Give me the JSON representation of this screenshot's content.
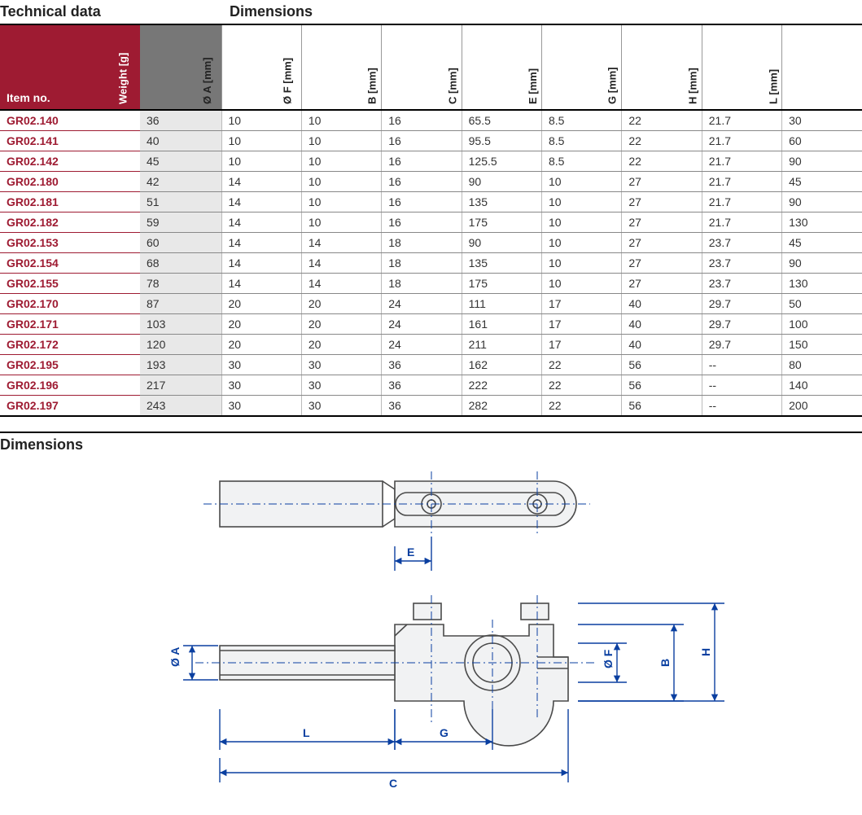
{
  "headings": {
    "technical_data": "Technical data",
    "dimensions": "Dimensions",
    "dimensions_lower": "Dimensions"
  },
  "columns": {
    "item_no": "Item no.",
    "weight": "Weight [g]",
    "a": "Ø A [mm]",
    "f": "Ø F [mm]",
    "b": "B [mm]",
    "c": "C [mm]",
    "e": "E [mm]",
    "g": "G [mm]",
    "h": "H [mm]",
    "l": "L [mm]"
  },
  "rows": [
    {
      "item": "GR02.140",
      "w": "36",
      "a": "10",
      "f": "10",
      "b": "16",
      "c": "65.5",
      "e": "8.5",
      "g": "22",
      "h": "21.7",
      "l": "30"
    },
    {
      "item": "GR02.141",
      "w": "40",
      "a": "10",
      "f": "10",
      "b": "16",
      "c": "95.5",
      "e": "8.5",
      "g": "22",
      "h": "21.7",
      "l": "60"
    },
    {
      "item": "GR02.142",
      "w": "45",
      "a": "10",
      "f": "10",
      "b": "16",
      "c": "125.5",
      "e": "8.5",
      "g": "22",
      "h": "21.7",
      "l": "90"
    },
    {
      "item": "GR02.180",
      "w": "42",
      "a": "14",
      "f": "10",
      "b": "16",
      "c": "90",
      "e": "10",
      "g": "27",
      "h": "21.7",
      "l": "45"
    },
    {
      "item": "GR02.181",
      "w": "51",
      "a": "14",
      "f": "10",
      "b": "16",
      "c": "135",
      "e": "10",
      "g": "27",
      "h": "21.7",
      "l": "90"
    },
    {
      "item": "GR02.182",
      "w": "59",
      "a": "14",
      "f": "10",
      "b": "16",
      "c": "175",
      "e": "10",
      "g": "27",
      "h": "21.7",
      "l": "130"
    },
    {
      "item": "GR02.153",
      "w": "60",
      "a": "14",
      "f": "14",
      "b": "18",
      "c": "90",
      "e": "10",
      "g": "27",
      "h": "23.7",
      "l": "45"
    },
    {
      "item": "GR02.154",
      "w": "68",
      "a": "14",
      "f": "14",
      "b": "18",
      "c": "135",
      "e": "10",
      "g": "27",
      "h": "23.7",
      "l": "90"
    },
    {
      "item": "GR02.155",
      "w": "78",
      "a": "14",
      "f": "14",
      "b": "18",
      "c": "175",
      "e": "10",
      "g": "27",
      "h": "23.7",
      "l": "130"
    },
    {
      "item": "GR02.170",
      "w": "87",
      "a": "20",
      "f": "20",
      "b": "24",
      "c": "111",
      "e": "17",
      "g": "40",
      "h": "29.7",
      "l": "50"
    },
    {
      "item": "GR02.171",
      "w": "103",
      "a": "20",
      "f": "20",
      "b": "24",
      "c": "161",
      "e": "17",
      "g": "40",
      "h": "29.7",
      "l": "100"
    },
    {
      "item": "GR02.172",
      "w": "120",
      "a": "20",
      "f": "20",
      "b": "24",
      "c": "211",
      "e": "17",
      "g": "40",
      "h": "29.7",
      "l": "150"
    },
    {
      "item": "GR02.195",
      "w": "193",
      "a": "30",
      "f": "30",
      "b": "36",
      "c": "162",
      "e": "22",
      "g": "56",
      "h": "--",
      "l": "80"
    },
    {
      "item": "GR02.196",
      "w": "217",
      "a": "30",
      "f": "30",
      "b": "36",
      "c": "222",
      "e": "22",
      "g": "56",
      "h": "--",
      "l": "140"
    },
    {
      "item": "GR02.197",
      "w": "243",
      "a": "30",
      "f": "30",
      "b": "36",
      "c": "282",
      "e": "22",
      "g": "56",
      "h": "--",
      "l": "200"
    }
  ],
  "drawing_labels": {
    "A": "Ø A",
    "F": "Ø F",
    "B": "B",
    "C": "C",
    "E": "E",
    "G": "G",
    "H": "H",
    "L": "L"
  }
}
